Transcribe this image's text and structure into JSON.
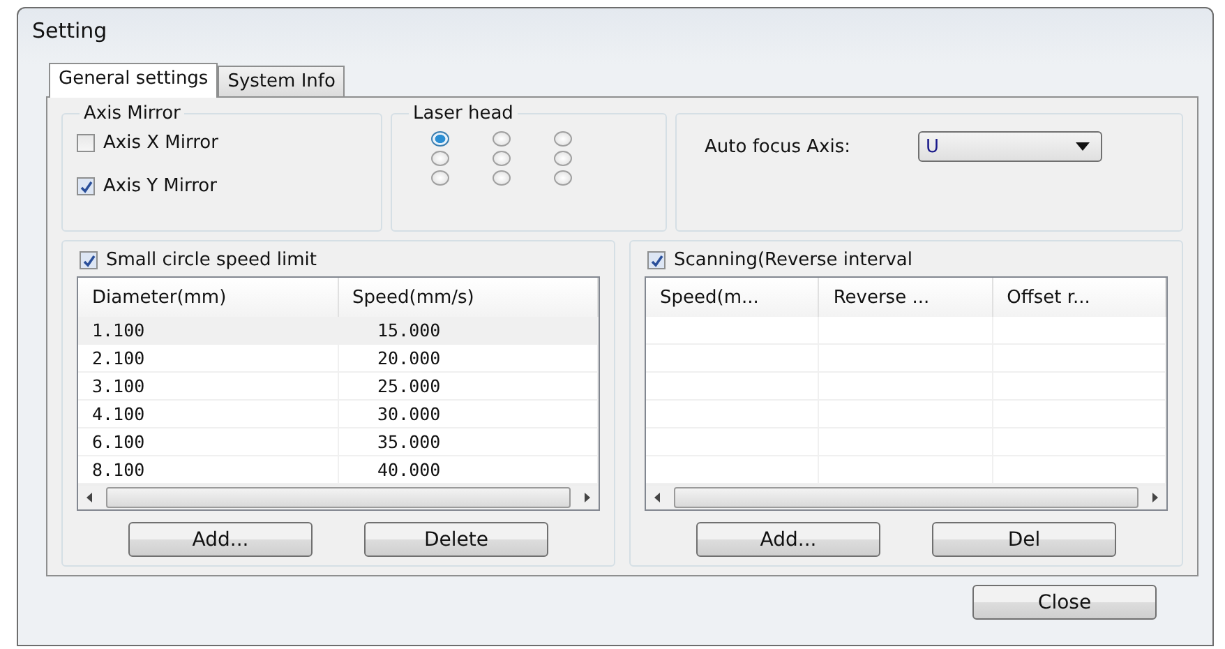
{
  "window": {
    "title": "Setting"
  },
  "tabs": [
    {
      "label": "General settings",
      "selected": true
    },
    {
      "label": "System Info",
      "selected": false
    }
  ],
  "axis_mirror": {
    "title": "Axis Mirror",
    "options": [
      {
        "label": "Axis X Mirror",
        "checked": false
      },
      {
        "label": "Axis Y Mirror",
        "checked": true
      }
    ]
  },
  "laser_head": {
    "title": "Laser head",
    "options": [
      {
        "selected": true
      },
      {
        "selected": false
      },
      {
        "selected": false
      },
      {
        "selected": false
      },
      {
        "selected": false
      },
      {
        "selected": false
      },
      {
        "selected": false
      },
      {
        "selected": false
      },
      {
        "selected": false
      }
    ]
  },
  "auto_focus": {
    "label": "Auto focus Axis:",
    "value": "U"
  },
  "small_circle": {
    "label": "Small circle speed limit",
    "checked": true,
    "columns": [
      "Diameter(mm)",
      "Speed(mm/s)"
    ],
    "rows": [
      {
        "cells": [
          "1.100",
          "15.000"
        ],
        "selected": true
      },
      {
        "cells": [
          "2.100",
          "20.000"
        ],
        "selected": false
      },
      {
        "cells": [
          "3.100",
          "25.000"
        ],
        "selected": false
      },
      {
        "cells": [
          "4.100",
          "30.000"
        ],
        "selected": false
      },
      {
        "cells": [
          "6.100",
          "35.000"
        ],
        "selected": false
      },
      {
        "cells": [
          "8.100",
          "40.000"
        ],
        "selected": false
      }
    ],
    "buttons": [
      "Add...",
      "Delete"
    ]
  },
  "scanning": {
    "label": "Scanning(Reverse interval",
    "checked": true,
    "columns": [
      "Speed(m...",
      "Reverse ...",
      "Offset r..."
    ],
    "buttons": [
      "Add...",
      "Del"
    ]
  },
  "buttons": [
    "Close"
  ]
}
